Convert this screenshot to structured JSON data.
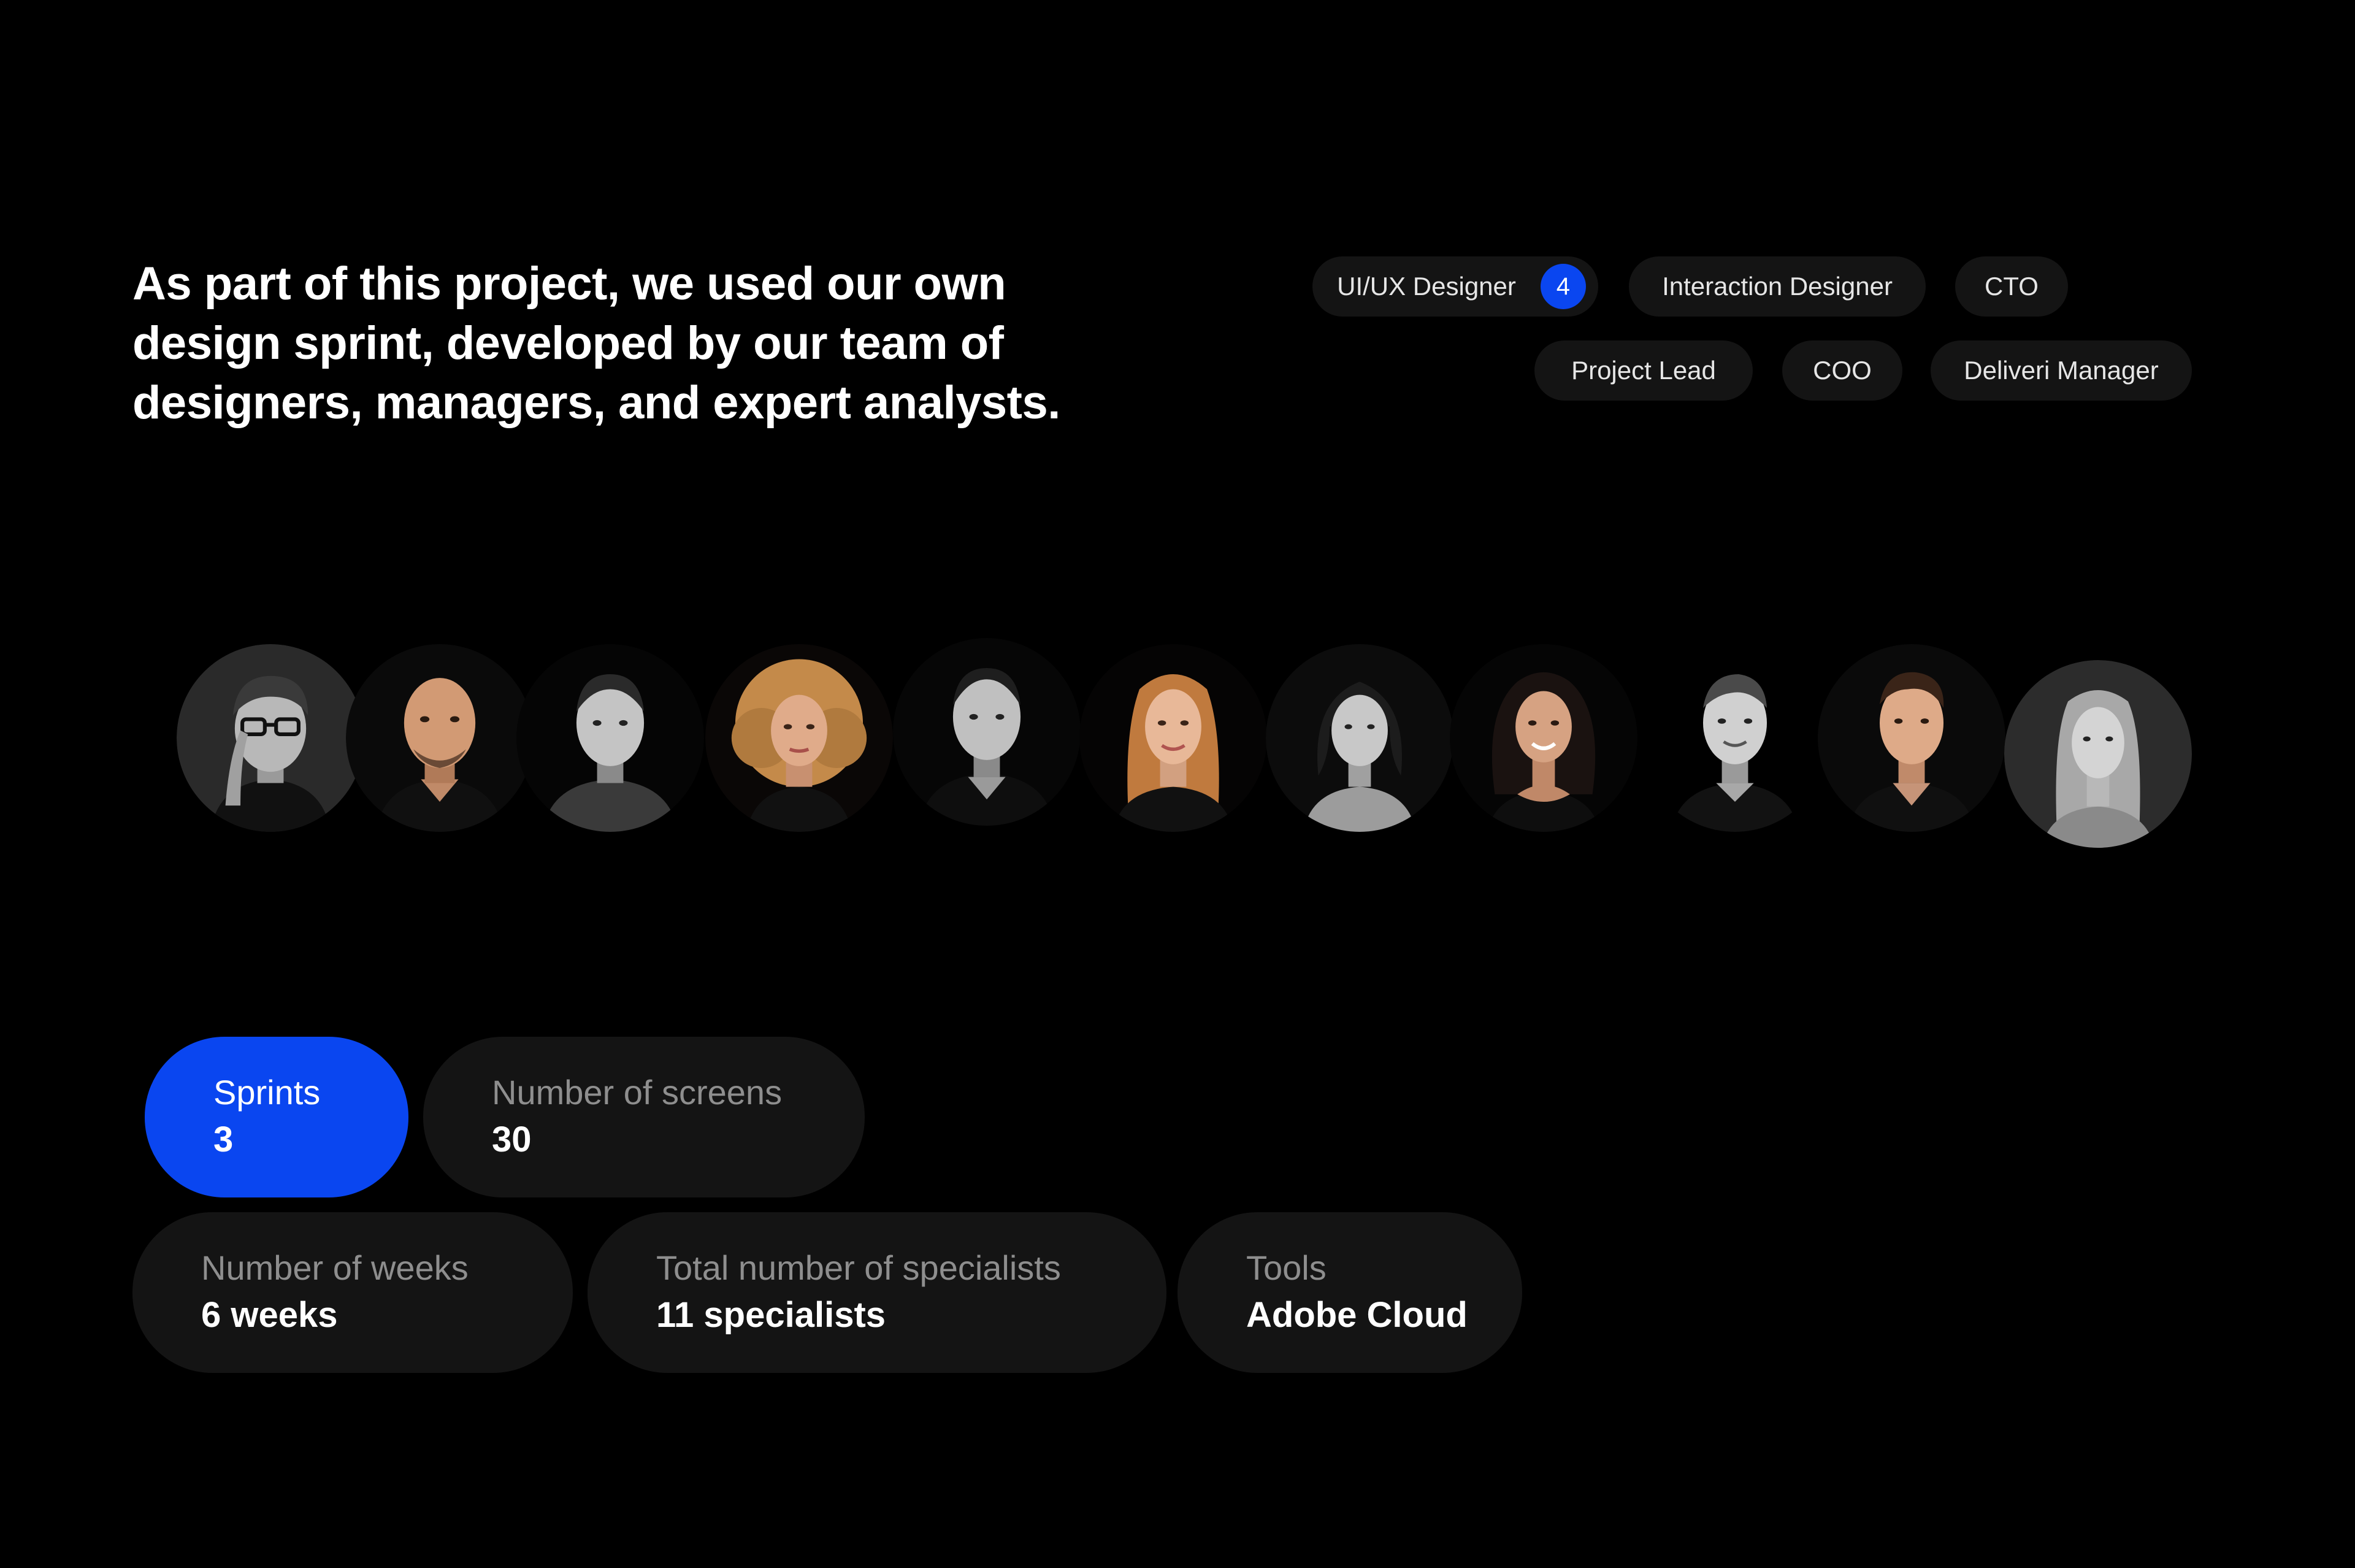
{
  "intro": {
    "lines": [
      "As part of this project, we used our own",
      "design sprint, developed by our team of",
      "designers, managers, and expert analysts."
    ]
  },
  "roles": [
    {
      "label": "UI/UX Designer",
      "count": "4"
    },
    {
      "label": "Interaction Designer"
    },
    {
      "label": "CTO"
    },
    {
      "label": "Project Lead"
    },
    {
      "label": "COO"
    },
    {
      "label": "Deliveri Manager"
    }
  ],
  "team": {
    "members": [
      {
        "style": "grayscale",
        "hair": "short",
        "glasses": true
      },
      {
        "style": "color",
        "hair": "bald"
      },
      {
        "style": "grayscale",
        "hair": "short"
      },
      {
        "style": "color",
        "hair": "curly-blonde"
      },
      {
        "style": "grayscale",
        "hair": "short"
      },
      {
        "style": "color",
        "hair": "long-red"
      },
      {
        "style": "grayscale",
        "hair": "bob"
      },
      {
        "style": "color",
        "hair": "curly-dark"
      },
      {
        "style": "grayscale",
        "hair": "short"
      },
      {
        "style": "color",
        "hair": "short-brown"
      },
      {
        "style": "grayscale",
        "hair": "long-light"
      }
    ]
  },
  "stats": [
    {
      "label": "Sprints",
      "value": "3",
      "active": true
    },
    {
      "label": "Number of screens",
      "value": "30"
    },
    {
      "label": "Number of weeks",
      "value": "6 weeks"
    },
    {
      "label": "Total number of specialists",
      "value": "11 specialists"
    },
    {
      "label": "Tools",
      "value": "Adobe Cloud"
    }
  ],
  "colors": {
    "background": "#000000",
    "accent": "#0a46f0",
    "pill": "#141414",
    "muted_text": "#8e8e8e"
  }
}
